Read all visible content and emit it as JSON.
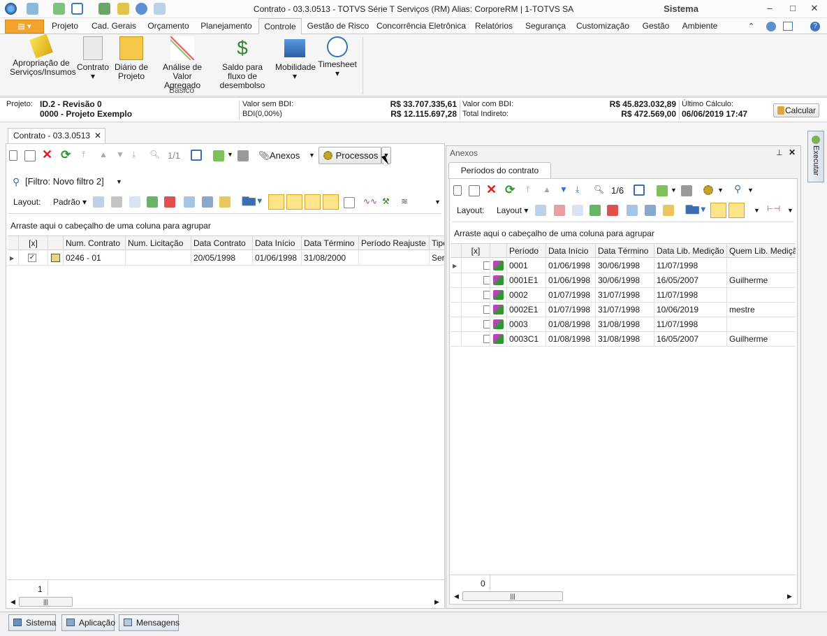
{
  "window": {
    "title": "Contrato - 03.3.0513 - TOTVS Série T Serviços (RM) Alias: CorporeRM | 1-TOTVS SA",
    "app_name": "Sistema"
  },
  "ribbon_tabs": [
    "Projeto",
    "Cad. Gerais",
    "Orçamento",
    "Planejamento",
    "Controle",
    "Gestão de Risco",
    "Concorrência Eletrônica",
    "Relatórios",
    "Segurança",
    "Customização",
    "Gestão",
    "Ambiente"
  ],
  "ribbon_buttons": {
    "apropriacao": "Apropriação de Serviços/Insumos",
    "contrato": "Contrato",
    "diario": "Diário de Projeto",
    "analise": "Análise de Valor Agregado",
    "saldo": "Saldo para fluxo de desembolso",
    "mobilidade": "Mobilidade",
    "timesheet": "Timesheet",
    "group": "Básico"
  },
  "info": {
    "projeto_label": "Projeto:",
    "projeto_line1": "ID.2 - Revisão 0",
    "projeto_line2": "0000 - Projeto Exemplo",
    "valor_sem_bdi_label": "Valor sem BDI:",
    "valor_sem_bdi": "R$ 33.707.335,61",
    "bdi_label": "BDI(0,00%)",
    "bdi_value": "R$ 12.115.697,28",
    "valor_com_bdi_label": "Valor com BDI:",
    "valor_com_bdi": "R$ 45.823.032,89",
    "total_indireto_label": "Total Indireto:",
    "total_indireto": "R$ 472.569,00",
    "ultimo_calculo_label": "Último Cálculo:",
    "ultimo_calculo": "06/06/2019 17:47",
    "calcular": "Calcular"
  },
  "doc_tab": "Contrato - 03.3.0513",
  "left": {
    "record_count": "1/1",
    "anexos": "Anexos",
    "processos": "Processos",
    "filter": "[Filtro: Novo filtro 2]",
    "layout_label": "Layout:",
    "layout_value": "Padrão",
    "group_hint": "Arraste aqui o cabeçalho de uma coluna para agrupar",
    "columns": [
      "[x]",
      "Num. Contrato",
      "Num. Licitação",
      "Data Contrato",
      "Data Início",
      "Data Término",
      "Período Reajuste",
      "Tipo"
    ],
    "rows": [
      {
        "num_contrato": "0246 - 01",
        "num_licitacao": "",
        "data_contrato": "20/05/1998",
        "data_inicio": "01/06/1998",
        "data_termino": "31/08/2000",
        "periodo_reajuste": "",
        "tipo": "Ser"
      }
    ],
    "footer_count": "1"
  },
  "right": {
    "panel_title": "Anexos",
    "tab": "Períodos do contrato",
    "record_count": "1/6",
    "layout_label": "Layout:",
    "layout_value": "Layout",
    "group_hint": "Arraste aqui o cabeçalho de uma coluna para agrupar",
    "columns": [
      "[x]",
      "Período",
      "Data Início",
      "Data Término",
      "Data Lib. Medição",
      "Quem Lib. Medição"
    ],
    "rows": [
      {
        "periodo": "0001",
        "inicio": "01/06/1998",
        "termino": "30/06/1998",
        "lib": "11/07/1998",
        "quem": ""
      },
      {
        "periodo": "0001E1",
        "inicio": "01/06/1998",
        "termino": "30/06/1998",
        "lib": "16/05/2007",
        "quem": "Guilherme"
      },
      {
        "periodo": "0002",
        "inicio": "01/07/1998",
        "termino": "31/07/1998",
        "lib": "11/07/1998",
        "quem": ""
      },
      {
        "periodo": "0002E1",
        "inicio": "01/07/1998",
        "termino": "31/07/1998",
        "lib": "10/06/2019",
        "quem": "mestre"
      },
      {
        "periodo": "0003",
        "inicio": "01/08/1998",
        "termino": "31/08/1998",
        "lib": "11/07/1998",
        "quem": ""
      },
      {
        "periodo": "0003C1",
        "inicio": "01/08/1998",
        "termino": "31/08/1998",
        "lib": "16/05/2007",
        "quem": "Guilherme"
      }
    ],
    "footer_count": "0"
  },
  "side_tab": "Executar",
  "status_tabs": [
    "Sistema",
    "Aplicação",
    "Mensagens"
  ],
  "colors": {
    "accent": "#f2a32b",
    "highlight": "#ffe48a",
    "selected_row": "#eaf2fb"
  }
}
